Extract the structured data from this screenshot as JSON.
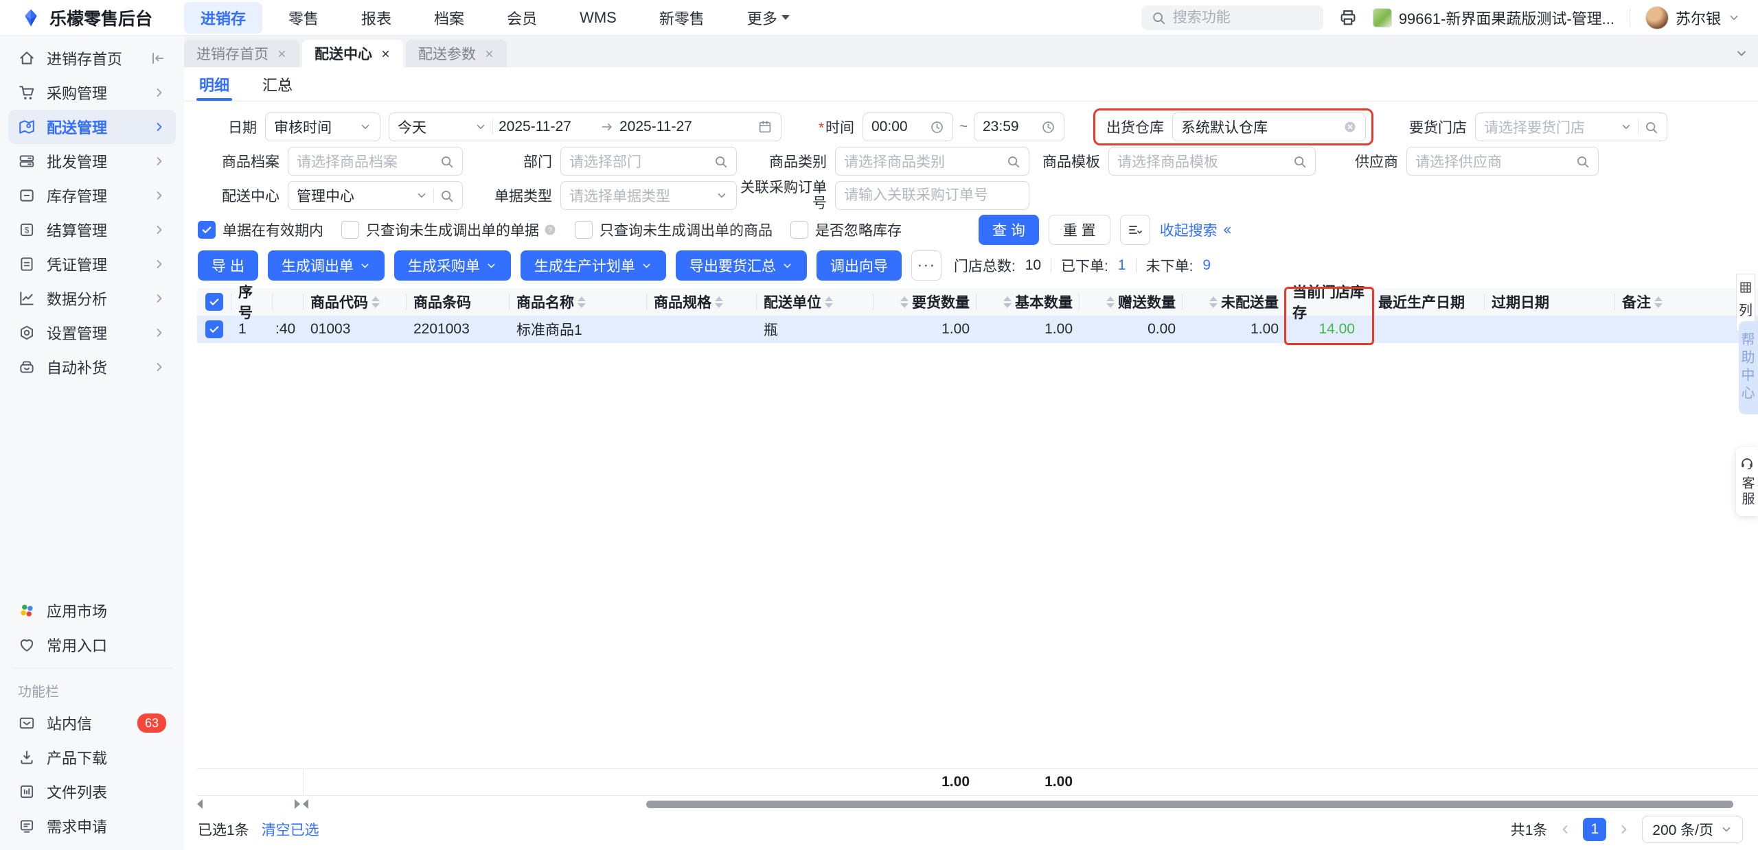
{
  "topbar": {
    "logo_text": "乐檬零售后台",
    "nav": [
      {
        "label": "进销存"
      },
      {
        "label": "零售"
      },
      {
        "label": "报表"
      },
      {
        "label": "档案"
      },
      {
        "label": "会员"
      },
      {
        "label": "WMS"
      },
      {
        "label": "新零售"
      },
      {
        "label": "更多"
      }
    ],
    "search_placeholder": "搜索功能",
    "store_name": "99661-新界面果蔬版测试-管理...",
    "user_name": "苏尔银"
  },
  "sidebar": {
    "items": [
      {
        "label": "进销存首页"
      },
      {
        "label": "采购管理"
      },
      {
        "label": "配送管理"
      },
      {
        "label": "批发管理"
      },
      {
        "label": "库存管理"
      },
      {
        "label": "结算管理"
      },
      {
        "label": "凭证管理"
      },
      {
        "label": "数据分析"
      },
      {
        "label": "设置管理"
      },
      {
        "label": "自动补货"
      }
    ],
    "apps_label": "应用市场",
    "favorites_label": "常用入口",
    "section_label": "功能栏",
    "tools": [
      {
        "label": "站内信",
        "badge": "63"
      },
      {
        "label": "产品下载"
      },
      {
        "label": "文件列表"
      },
      {
        "label": "需求申请"
      }
    ]
  },
  "tabs": [
    {
      "label": "进销存首页"
    },
    {
      "label": "配送中心"
    },
    {
      "label": "配送参数"
    }
  ],
  "view_tabs": {
    "detail": "明细",
    "summary": "汇总"
  },
  "filters": {
    "required_mark": "*",
    "date_label": "日期",
    "date_type_value": "审核时间",
    "date_preset_value": "今天",
    "date_from": "2025-11-27",
    "date_to": "2025-11-27",
    "time_label": "时间",
    "time_from": "00:00",
    "time_separator": "~",
    "time_to": "23:59",
    "warehouse_label": "出货仓库",
    "warehouse_value": "系统默认仓库",
    "store_label": "要货门店",
    "store_placeholder": "请选择要货门店",
    "goods_label": "商品档案",
    "goods_placeholder": "请选择商品档案",
    "dept_label": "部门",
    "dept_placeholder": "请选择部门",
    "category_label": "商品类别",
    "category_placeholder": "请选择商品类别",
    "template_label": "商品模板",
    "template_placeholder": "请选择商品模板",
    "supplier_label": "供应商",
    "supplier_placeholder": "请选择供应商",
    "center_label": "配送中心",
    "center_value": "管理中心",
    "doctype_label": "单据类型",
    "doctype_placeholder": "请选择单据类型",
    "po_label": "关联采购订单号",
    "po_placeholder": "请输入关联采购订单号"
  },
  "filter_checkboxes": [
    {
      "label": "单据在有效期内",
      "checked": true
    },
    {
      "label": "只查询未生成调出单的单据",
      "checked": false
    },
    {
      "label": "只查询未生成调出单的商品",
      "checked": false
    },
    {
      "label": "是否忽略库存",
      "checked": false
    }
  ],
  "search_actions": {
    "query": "查 询",
    "reset": "重 置",
    "collapse": "收起搜索"
  },
  "toolbar": {
    "export": "导 出",
    "gen_transfer": "生成调出单",
    "gen_purchase": "生成采购单",
    "gen_production": "生成生产计划单",
    "export_summary": "导出要货汇总",
    "transfer_wizard": "调出向导",
    "more": "···",
    "stats": {
      "total_label": "门店总数:",
      "total_value": "10",
      "ordered_label": "已下单:",
      "ordered_value": "1",
      "unordered_label": "未下单:",
      "unordered_value": "9"
    }
  },
  "table": {
    "columns": [
      {
        "label": "序号"
      },
      {
        "label": ""
      },
      {
        "label": "商品代码"
      },
      {
        "label": "商品条码"
      },
      {
        "label": "商品名称"
      },
      {
        "label": "商品规格"
      },
      {
        "label": "配送单位"
      },
      {
        "label": "要货数量"
      },
      {
        "label": "基本数量"
      },
      {
        "label": "赠送数量"
      },
      {
        "label": "未配送量"
      },
      {
        "label": "当前门店库存"
      },
      {
        "label": "最近生产日期"
      },
      {
        "label": "过期日期"
      },
      {
        "label": "备注"
      }
    ],
    "rows": [
      [
        "1",
        ":40",
        "01003",
        "2201003",
        "标准商品1",
        "",
        "瓶",
        "1.00",
        "1.00",
        "0.00",
        "1.00",
        "14.00",
        "",
        "",
        ""
      ]
    ],
    "summary": {
      "request_qty": "1.00",
      "base_qty": "1.00"
    },
    "column_tool_label": "列"
  },
  "footer": {
    "selected_text": "已选1条",
    "clear_text": "清空已选",
    "total_text": "共1条",
    "current_page": "1",
    "page_size": "200 条/页"
  },
  "floating": {
    "help_text": "帮助中心",
    "service_text": "客服"
  },
  "colors": {
    "primary": "#3370ff",
    "highlight_red": "#e23c2c",
    "stock_green": "#3eb849",
    "badge_red": "#f5483b"
  }
}
